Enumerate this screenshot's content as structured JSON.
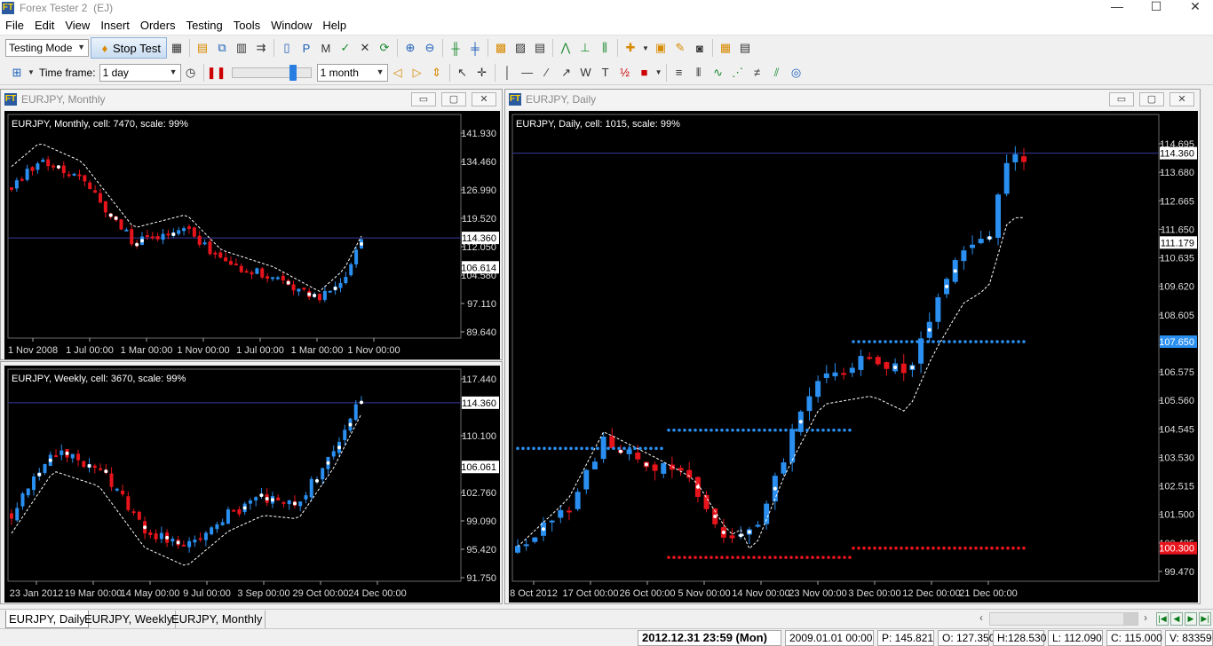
{
  "app": {
    "title": "Forex Tester 2",
    "title_suffix": "(EJ)"
  },
  "menu": [
    "File",
    "Edit",
    "View",
    "Insert",
    "Orders",
    "Testing",
    "Tools",
    "Window",
    "Help"
  ],
  "toolbar": {
    "mode_value": "Testing Mode",
    "stop_label": "Stop Test",
    "timeframe_label": "Time frame:",
    "timeframe_value": "1 day",
    "period_value": "1 month",
    "speed_level": 0.78
  },
  "windows": {
    "monthly": {
      "title": "EURJPY, Monthly",
      "info": "EURJPY, Monthly, cell: 7470, scale: 99%",
      "price_labels": [
        "141.930",
        "134.460",
        "126.990",
        "119.520",
        "112.050",
        "104.580",
        "97.110",
        "89.640"
      ],
      "current_price": "114.360",
      "ma_price": "106.614",
      "date_labels": [
        "1 Nov 2008",
        "1 Jul 00:00",
        "1 Mar 00:00",
        "1 Nov 00:00",
        "1 Jul 00:00",
        "1 Mar 00:00",
        "1 Nov 00:00"
      ]
    },
    "weekly": {
      "title": "EURJPY, Weekly",
      "info": "EURJPY, Weekly, cell: 3670, scale: 99%",
      "price_labels": [
        "117.440",
        "110.100",
        "102.760",
        "99.090",
        "95.420",
        "91.750"
      ],
      "current_price": "114.360",
      "ma_price": "106.061",
      "date_labels": [
        "23 Jan 2012",
        "19 Mar 00:00",
        "14 May 00:00",
        "9 Jul 00:00",
        "3 Sep 00:00",
        "29 Oct 00:00",
        "24 Dec 00:00"
      ]
    },
    "daily": {
      "title": "EURJPY, Daily",
      "info": "EURJPY, Daily, cell: 1015, scale: 99%",
      "price_labels": [
        "114.695",
        "113.680",
        "112.665",
        "111.650",
        "110.635",
        "109.620",
        "108.605",
        "106.575",
        "105.560",
        "104.545",
        "103.530",
        "102.515",
        "101.500",
        "100.485",
        "99.470"
      ],
      "current_price": "114.360",
      "ma_price": "111.179",
      "blue_level": "107.650",
      "red_level": "100.300",
      "date_labels": [
        "8 Oct 2012",
        "17 Oct 00:00",
        "26 Oct 00:00",
        "5 Nov 00:00",
        "14 Nov 00:00",
        "23 Nov 00:00",
        "3 Dec 00:00",
        "12 Dec 00:00",
        "21 Dec 00:00"
      ]
    }
  },
  "tabs": [
    "EURJPY, Daily",
    "EURJPY, Weekly",
    "EURJPY, Monthly"
  ],
  "status": {
    "datetime": "2012.12.31  23:59 (Mon)",
    "start": "2009.01.01 00:00",
    "p": "P: 145.821",
    "o": "O: 127.350",
    "h": "H:128.530",
    "l": "L: 112.090",
    "c": "C: 115.000",
    "v": "V: 83359"
  },
  "colors": {
    "bull": "#2a8ff0",
    "bear": "#e8141c",
    "grid": "#555555",
    "price_line": "#3a3aa0",
    "blue_level": "#2a8ff0",
    "red_level": "#e8141c"
  }
}
